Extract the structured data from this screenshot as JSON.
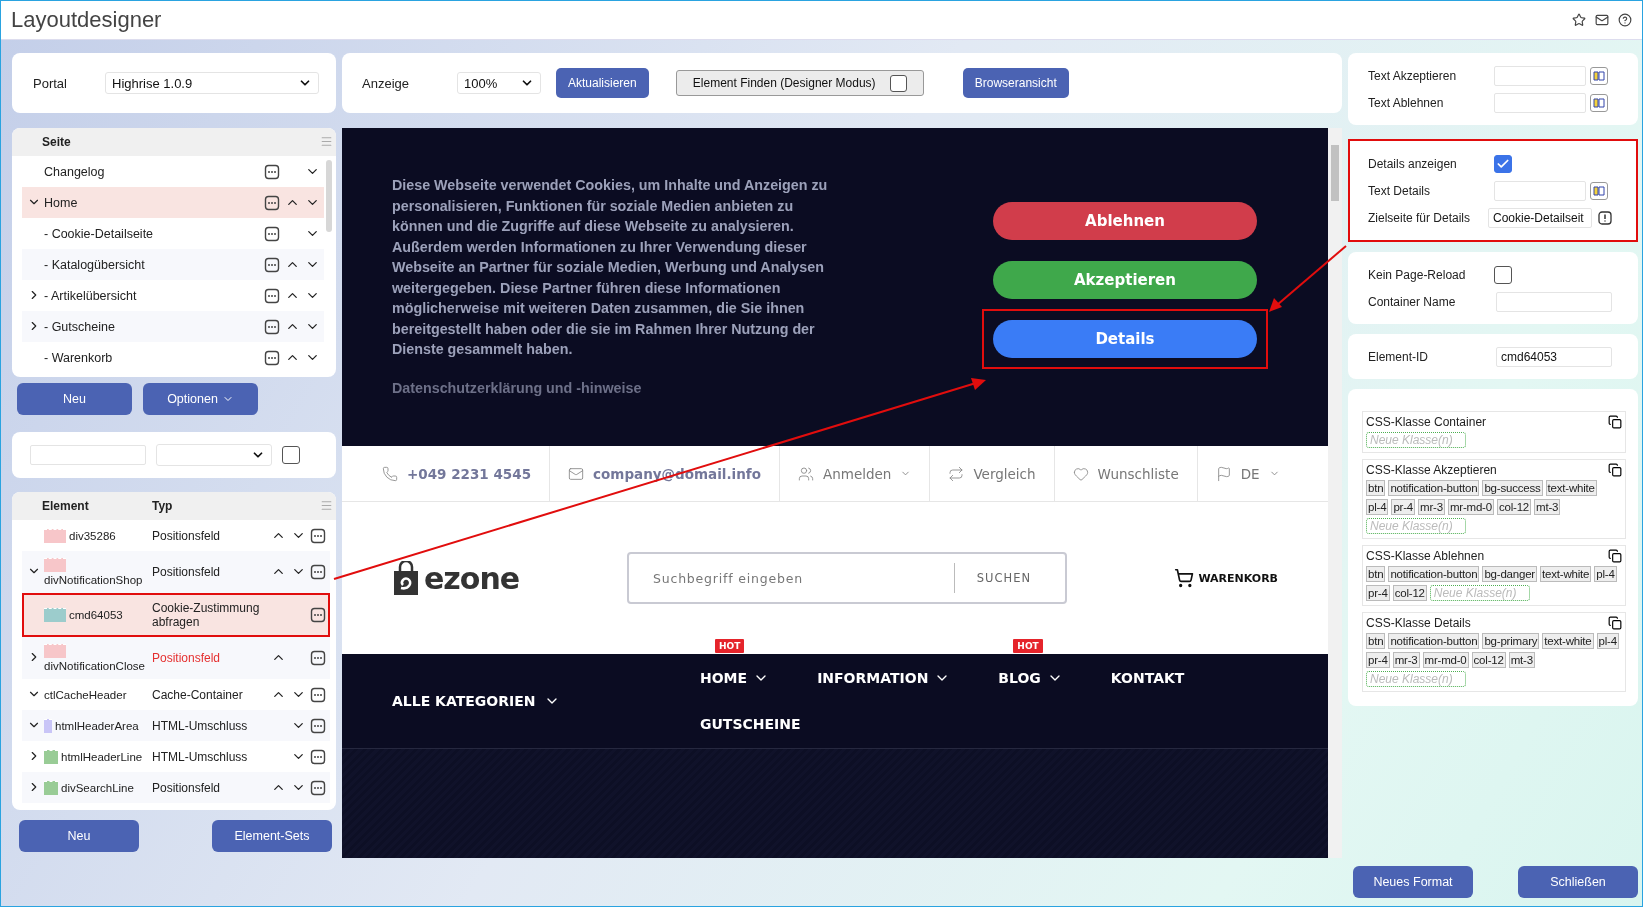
{
  "window": {
    "title": "Layoutdesigner"
  },
  "portal": {
    "label": "Portal",
    "value": "Highrise 1.0.9"
  },
  "pages": {
    "header": "Seite",
    "items": [
      {
        "label": "Changelog",
        "expandable": false,
        "selected": false,
        "up": false,
        "down": true
      },
      {
        "label": "Home",
        "expandable": true,
        "expanded": true,
        "selected": true,
        "up": true,
        "down": true
      },
      {
        "label": "- Cookie-Detailseite",
        "expandable": false,
        "selected": false,
        "up": false,
        "down": true
      },
      {
        "label": "- Katalogübersicht",
        "expandable": false,
        "selected": false,
        "up": true,
        "down": true
      },
      {
        "label": "- Artikelübersicht",
        "expandable": true,
        "expanded": false,
        "selected": false,
        "up": true,
        "down": true
      },
      {
        "label": "- Gutscheine",
        "expandable": true,
        "expanded": false,
        "selected": false,
        "up": true,
        "down": true
      },
      {
        "label": "- Warenkorb",
        "expandable": false,
        "selected": false,
        "up": true,
        "down": true
      }
    ]
  },
  "page_buttons": [
    {
      "label": "Neu",
      "dropdown": false
    },
    {
      "label": "Optionen",
      "dropdown": true
    }
  ],
  "filter": {
    "checked": false
  },
  "elements": {
    "columns": [
      "Element",
      "Typ"
    ],
    "items": [
      {
        "name": "div35286",
        "type": "Positionsfeld",
        "expandable": false,
        "color": "#f7c6c9",
        "selected": false,
        "highlighted": false,
        "warning": false,
        "up": true,
        "down": true
      },
      {
        "name": "divNotificationShop",
        "type": "Positionsfeld",
        "expandable": true,
        "expanded": true,
        "color": "#f7c6c9",
        "selected": false,
        "highlighted": false,
        "warning": false,
        "up": true,
        "down": true
      },
      {
        "name": "cmd64053",
        "type": "Cookie-Zustimmung abfragen",
        "expandable": false,
        "color": "#9ccccc",
        "selected": true,
        "highlighted": true,
        "warning": false,
        "up": false,
        "down": false
      },
      {
        "name": "divNotificationClose",
        "type": "Positionsfeld",
        "expandable": true,
        "expanded": false,
        "color": "#f7c6c9",
        "selected": false,
        "highlighted": false,
        "warning": true,
        "up": true,
        "down": false
      },
      {
        "name": "ctlCacheHeader",
        "type": "Cache-Container",
        "expandable": true,
        "expanded": true,
        "selected": false,
        "highlighted": false,
        "warning": false,
        "up": true,
        "down": true
      },
      {
        "name": "htmlHeaderArea",
        "type": "HTML-Umschluss",
        "expandable": true,
        "expanded": true,
        "color": "#c9c5f7",
        "selected": false,
        "highlighted": false,
        "warning": false,
        "up": false,
        "down": true
      },
      {
        "name": "htmlHeaderLine",
        "type": "HTML-Umschluss",
        "expandable": true,
        "expanded": false,
        "color": "#99cc96",
        "selected": false,
        "highlighted": false,
        "warning": false,
        "up": false,
        "down": true
      },
      {
        "name": "divSearchLine",
        "type": "Positionsfeld",
        "expandable": true,
        "expanded": false,
        "color": "#99cc96",
        "selected": false,
        "highlighted": false,
        "warning": false,
        "up": true,
        "down": true
      }
    ]
  },
  "element_buttons": [
    "Neu",
    "Element-Sets"
  ],
  "toolbar": {
    "zoom_label": "Anzeige",
    "zoom": "100%",
    "refresh": "Aktualisieren",
    "finder": {
      "label": "Element Finden (Designer Modus)",
      "checked": false
    },
    "browser_view": "Browseransicht"
  },
  "preview": {
    "banner": {
      "text": "Diese Webseite verwendet Cookies, um Inhalte und Anzeigen zu personalisieren, Funktionen für soziale Medien anbieten zu können und die Zugriffe auf diese Webseite zu analysieren. Außerdem werden Informationen zu Ihrer Verwendung dieser Webseite an Partner für soziale Medien, Werbung und Analysen weitergegeben. Diese Partner führen diese Informationen möglicherweise mit weiteren Daten zusammen, die Sie ihnen bereitgestellt haben oder die sie im Rahmen Ihrer Nutzung der Dienste gesammelt haben.",
      "link": "Datenschutzerklärung und -hinweise",
      "buttons": [
        {
          "label": "Ablehnen",
          "color": "#d13d4b",
          "highlighted": false
        },
        {
          "label": "Akzeptieren",
          "color": "#3fa84b",
          "highlighted": false
        },
        {
          "label": "Details",
          "color": "#3a7cf6",
          "highlighted": true
        }
      ]
    },
    "topbar": [
      {
        "label": "+049 2231 4545",
        "bold": true,
        "dropdown": false
      },
      {
        "label": "company@domail.info",
        "bold": true,
        "dropdown": false
      },
      {
        "label": "Anmelden",
        "bold": false,
        "dropdown": true
      },
      {
        "label": "Vergleich",
        "bold": false,
        "dropdown": false
      },
      {
        "label": "Wunschliste",
        "bold": false,
        "dropdown": false
      },
      {
        "label": "DE",
        "bold": false,
        "dropdown": true
      }
    ],
    "logo": "ezone",
    "search": {
      "placeholder": "Suchbegriff eingeben",
      "button": "SUCHEN"
    },
    "cart": "WARENKORB",
    "categories": "ALLE KATEGORIEN",
    "menu": [
      {
        "label": "HOME",
        "badge": "HOT",
        "dropdown": true
      },
      {
        "label": "INFORMATION",
        "dropdown": true
      },
      {
        "label": "BLOG",
        "badge": "HOT",
        "dropdown": true
      },
      {
        "label": "KONTAKT",
        "dropdown": false
      },
      {
        "label": "GUTSCHEINE",
        "dropdown": false
      }
    ]
  },
  "settings": [
    {
      "highlighted": false,
      "fields": [
        {
          "kind": "translatable",
          "label": "Text Akzeptieren"
        },
        {
          "kind": "translatable",
          "label": "Text Ablehnen"
        }
      ]
    },
    {
      "highlighted": true,
      "fields": [
        {
          "kind": "checkbox",
          "label": "Details anzeigen",
          "checked": true
        },
        {
          "kind": "translatable",
          "label": "Text Details"
        },
        {
          "kind": "page_link",
          "label": "Zielseite für Details",
          "value": "Cookie-Detailseit"
        }
      ]
    },
    {
      "highlighted": false,
      "fields": [
        {
          "kind": "checkbox",
          "label": "Kein Page-Reload",
          "checked": false
        },
        {
          "kind": "text",
          "label": "Container Name"
        }
      ]
    },
    {
      "highlighted": false,
      "fields": [
        {
          "kind": "text",
          "label": "Element-ID",
          "value": "cmd64053"
        }
      ]
    }
  ],
  "css_classes": [
    {
      "title": "CSS-Klasse Container",
      "placeholder": "Neue Klasse(n)"
    },
    {
      "title": "CSS-Klasse Akzeptieren",
      "tags": [
        "btn",
        "notification-button",
        "bg-success",
        "text-white",
        "pl-4",
        "pr-4",
        "mr-3",
        "mr-md-0",
        "col-12",
        "mt-3"
      ],
      "placeholder": "Neue Klasse(n)"
    },
    {
      "title": "CSS-Klasse Ablehnen",
      "tags": [
        "btn",
        "notification-button",
        "bg-danger",
        "text-white",
        "pl-4",
        "pr-4",
        "col-12"
      ],
      "placeholder": "Neue Klasse(n)"
    },
    {
      "title": "CSS-Klasse Details",
      "tags": [
        "btn",
        "notification-button",
        "bg-primary",
        "text-white",
        "pl-4",
        "pr-4",
        "mr-3",
        "mr-md-0",
        "col-12",
        "mt-3"
      ],
      "placeholder": "Neue Klasse(n)"
    }
  ],
  "footer_buttons": [
    "Neues Format",
    "Schließen"
  ]
}
